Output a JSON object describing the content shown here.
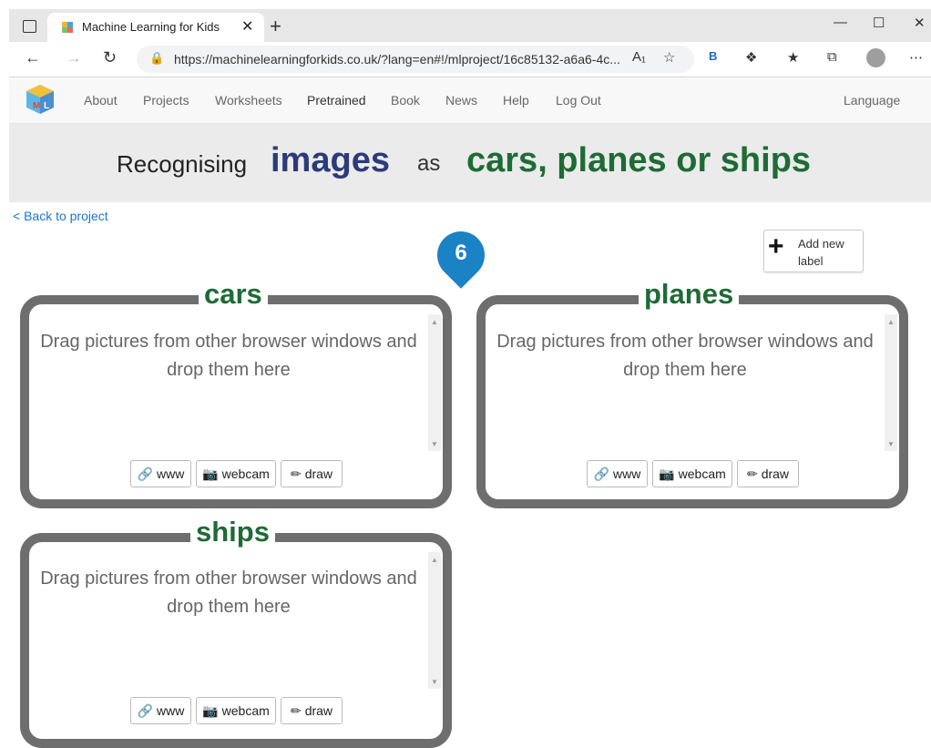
{
  "browser": {
    "tab_title": "Machine Learning for Kids",
    "tab_close": "✕",
    "new_tab": "+",
    "url": "https://machinelearningforkids.co.uk/?lang=en#!/mlproject/16c85132-a6a6-4c...",
    "window_controls": [
      "—",
      "☐",
      "✕"
    ]
  },
  "nav": {
    "links": [
      "About",
      "Projects",
      "Worksheets",
      "Pretrained",
      "Book",
      "News",
      "Help",
      "Log Out"
    ],
    "language": "Language"
  },
  "banner": {
    "prefix": "Recognising",
    "type": "images",
    "as": "as",
    "labels": "cars, planes or ships"
  },
  "back_link": "< Back to project",
  "add_label": {
    "plus": "+",
    "text": "Add new label"
  },
  "step_marker": "6",
  "buckets": [
    {
      "name": "cars",
      "drop_text": "Drag pictures from other browser windows and drop them here",
      "btn_www": "www",
      "btn_webcam": "webcam",
      "btn_draw": "draw"
    },
    {
      "name": "planes",
      "drop_text": "Drag pictures from other browser windows and drop them here",
      "btn_www": "www",
      "btn_webcam": "webcam",
      "btn_draw": "draw"
    },
    {
      "name": "ships",
      "drop_text": "Drag pictures from other browser windows and drop them here",
      "btn_www": "www",
      "btn_webcam": "webcam",
      "btn_draw": "draw"
    }
  ],
  "icons": {
    "link": "link-icon",
    "camera": "camera-icon",
    "pencil": "pencil-icon"
  },
  "colors": {
    "images": "#2b3a7a",
    "labels": "#1e6b35",
    "marker": "#1b82c5",
    "box_border": "#6e6e6e"
  }
}
